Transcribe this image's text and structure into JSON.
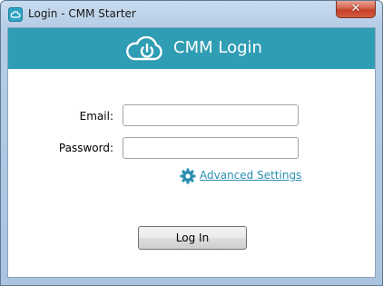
{
  "window": {
    "title": "Login - CMM Starter",
    "close_label": "✕"
  },
  "banner": {
    "title": "CMM Login",
    "logo_icon": "cloud-power-icon",
    "color": "#2f9db4"
  },
  "form": {
    "email_label": "Email:",
    "email_value": "",
    "password_label": "Password:",
    "password_value": "",
    "advanced_settings_label": "Advanced Settings",
    "advanced_settings_icon": "gear-icon",
    "login_button_label": "Log In"
  },
  "colors": {
    "accent": "#2f9db4",
    "link": "#2b8fb0"
  }
}
